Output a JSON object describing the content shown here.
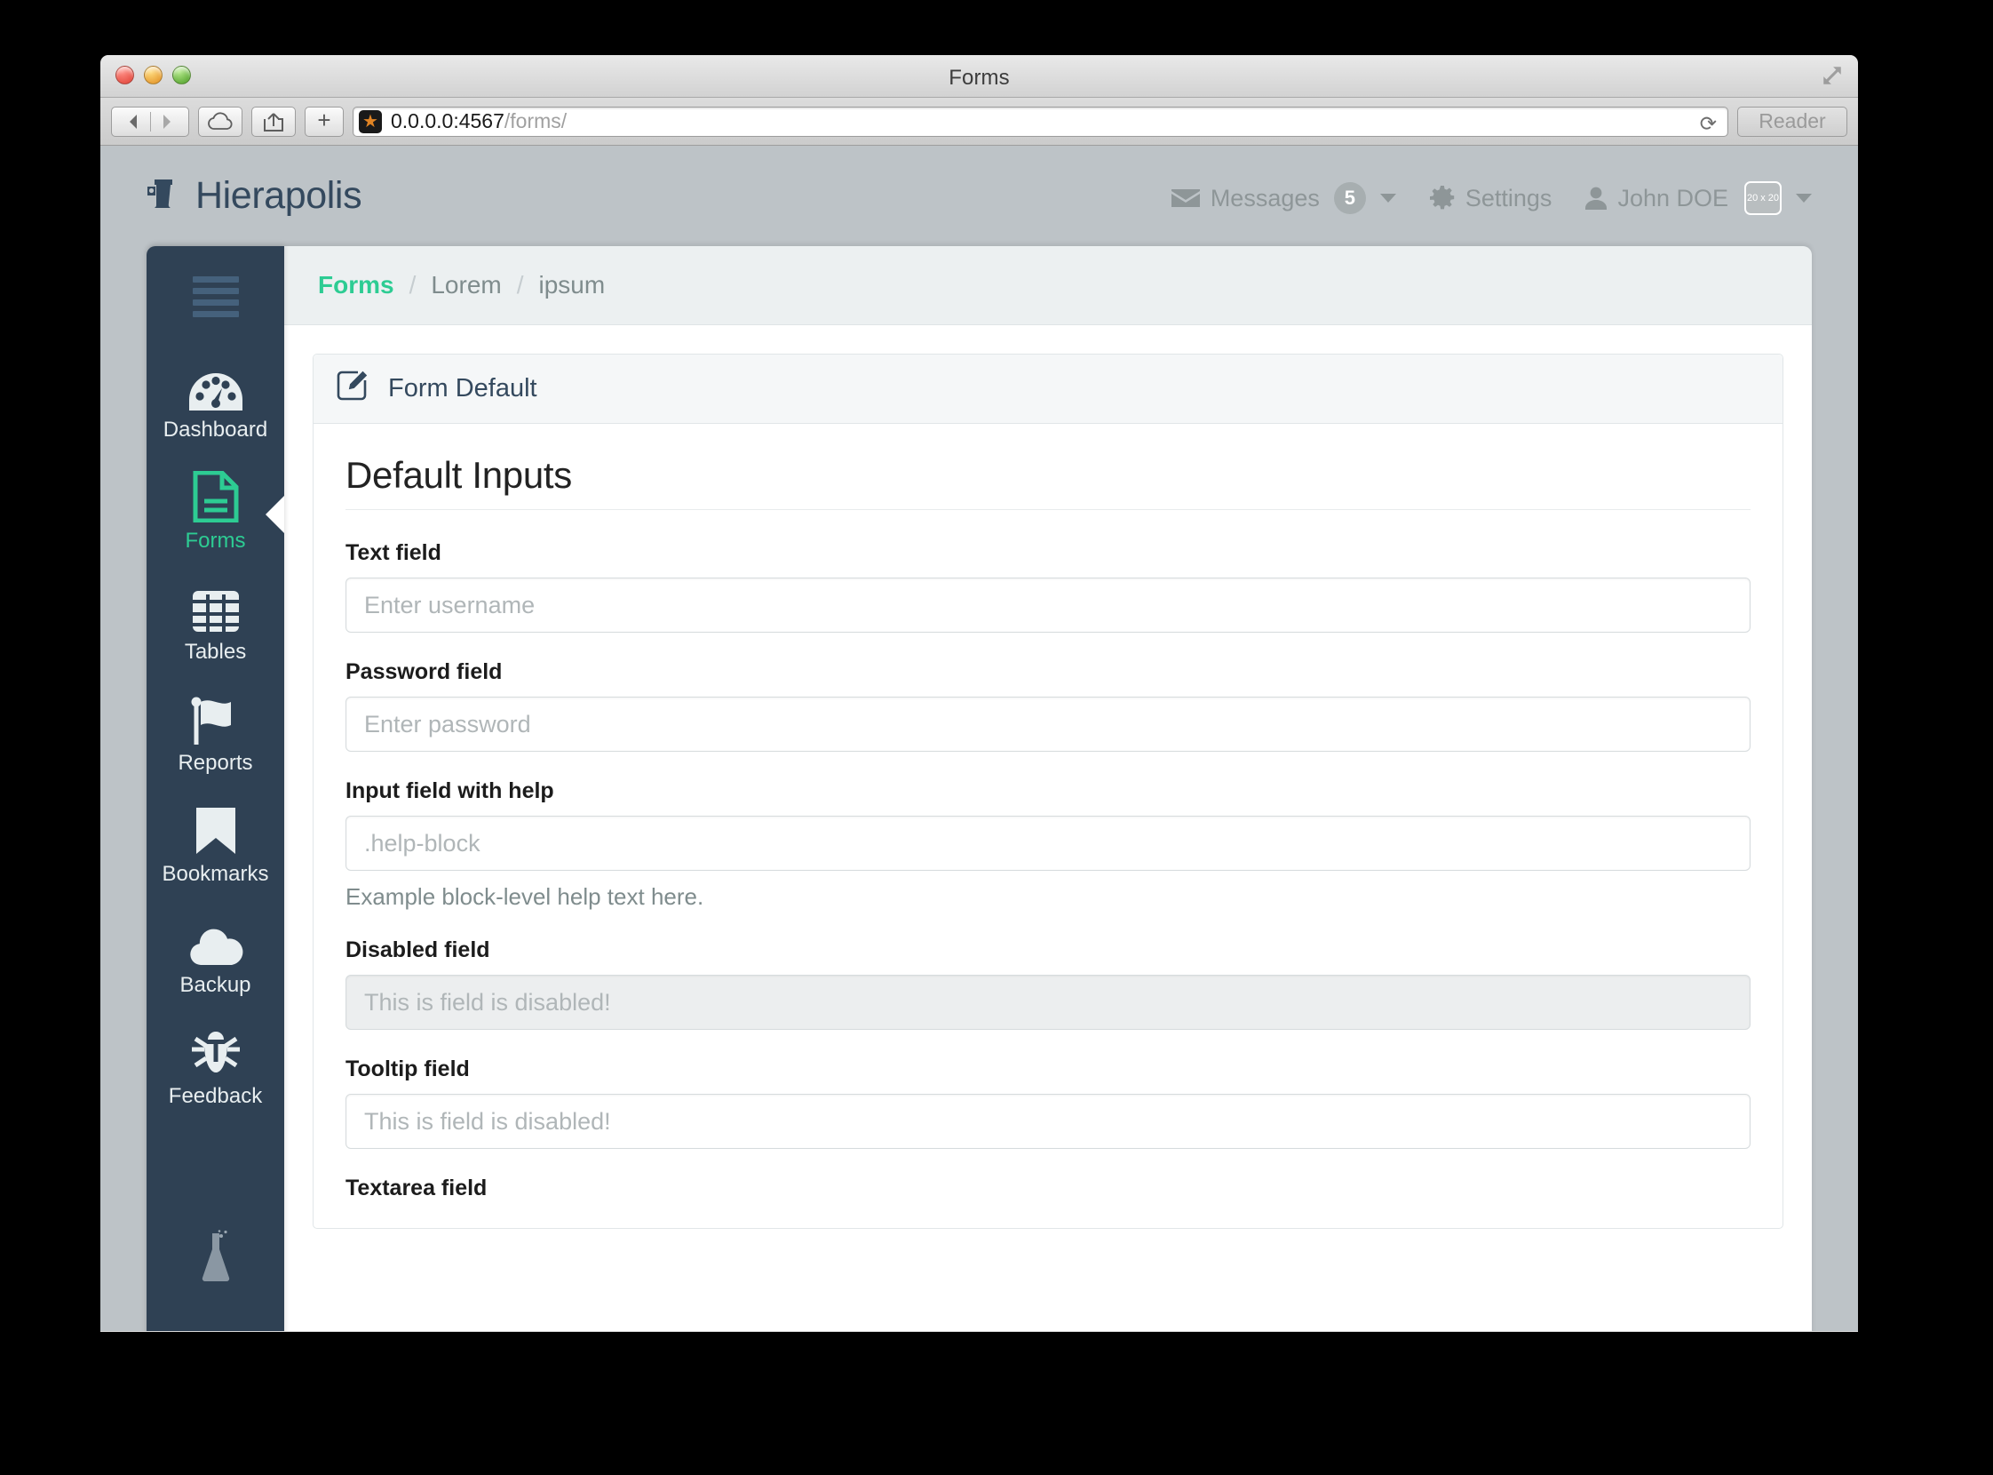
{
  "browser": {
    "window_title": "Forms",
    "url_host": "0.0.0.0:4567",
    "url_path": "/forms/",
    "reader_label": "Reader",
    "new_tab_label": "+",
    "reload_icon": "reload-icon",
    "site_icon": "star-icon"
  },
  "app": {
    "brand": "Hierapolis",
    "header_nav": {
      "messages_label": "Messages",
      "messages_count": "5",
      "settings_label": "Settings",
      "user_name": "John DOE",
      "avatar_placeholder": "20 x 20"
    }
  },
  "sidebar": {
    "items": [
      {
        "label": "Dashboard",
        "icon": "dashboard-gauge-icon",
        "active": false
      },
      {
        "label": "Forms",
        "icon": "document-lines-icon",
        "active": true
      },
      {
        "label": "Tables",
        "icon": "table-grid-icon",
        "active": false
      },
      {
        "label": "Reports",
        "icon": "flag-icon",
        "active": false
      },
      {
        "label": "Bookmarks",
        "icon": "bookmark-icon",
        "active": false
      },
      {
        "label": "Backup",
        "icon": "cloud-icon",
        "active": false
      },
      {
        "label": "Feedback",
        "icon": "bug-icon",
        "active": false
      }
    ],
    "footer_icon": "flask-icon",
    "menu_toggle_icon": "hamburger-icon"
  },
  "breadcrumb": {
    "items": [
      "Forms",
      "Lorem",
      "ipsum"
    ],
    "separator": "/"
  },
  "panel": {
    "title": "Form Default",
    "icon": "edit-pencil-square-icon",
    "section_title": "Default Inputs",
    "fields": [
      {
        "label": "Text field",
        "placeholder": "Enter username",
        "value": "",
        "type": "text",
        "disabled": false,
        "help": ""
      },
      {
        "label": "Password field",
        "placeholder": "Enter password",
        "value": "",
        "type": "text",
        "disabled": false,
        "help": ""
      },
      {
        "label": "Input field with help",
        "placeholder": ".help-block",
        "value": "",
        "type": "text",
        "disabled": false,
        "help": "Example block-level help text here."
      },
      {
        "label": "Disabled field",
        "placeholder": "This is field is disabled!",
        "value": "",
        "type": "text",
        "disabled": true,
        "help": ""
      },
      {
        "label": "Tooltip field",
        "placeholder": "This is field is disabled!",
        "value": "",
        "type": "text",
        "disabled": false,
        "help": ""
      },
      {
        "label": "Textarea field",
        "placeholder": "",
        "value": "",
        "type": "textarea",
        "disabled": false,
        "help": ""
      }
    ]
  },
  "colors": {
    "accent_green": "#2dcc93",
    "sidebar_navy": "#2f4154",
    "brand_navy": "#34495e",
    "page_bg": "#bdc3c7",
    "content_bg": "#ecf0f1",
    "muted_text": "#7f8c8d"
  }
}
